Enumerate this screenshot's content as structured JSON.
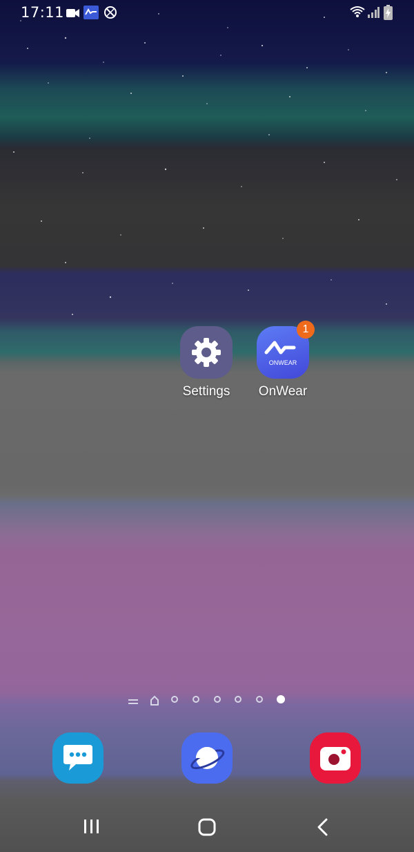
{
  "status_bar": {
    "time": "17:11",
    "left_icons": [
      "video-camera-icon",
      "onwear-notification-icon",
      "do-not-disturb-icon"
    ],
    "right_icons": [
      "wifi-icon",
      "signal-icon",
      "battery-charging-icon"
    ]
  },
  "home": {
    "apps": [
      {
        "label": "Settings",
        "icon": "gear-icon",
        "color": "#5e5c8a"
      },
      {
        "label": "OnWear",
        "icon": "onwear-logo-icon",
        "icon_text": "ONWEAR",
        "badge": "1",
        "color": "#4f63e6"
      }
    ]
  },
  "page_indicator": {
    "pages": 8,
    "active_index": 7
  },
  "dock": {
    "apps": [
      {
        "name": "Messages",
        "icon": "chat-bubble-icon",
        "color": "#1a9ad6"
      },
      {
        "name": "Internet",
        "icon": "planet-icon",
        "color": "#4c6cf0"
      },
      {
        "name": "Camera",
        "icon": "camera-icon",
        "color": "#e8183c"
      }
    ]
  },
  "nav_bar": {
    "buttons": [
      "recents-button",
      "home-button",
      "back-button"
    ]
  }
}
